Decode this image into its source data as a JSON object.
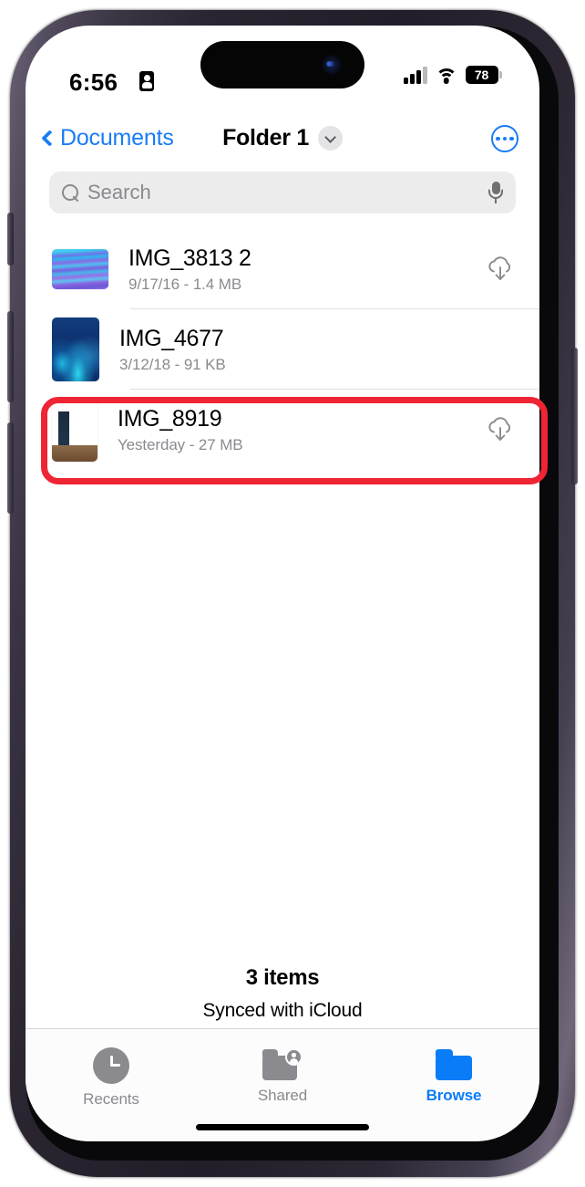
{
  "status_bar": {
    "time": "6:56",
    "focus_icon": "id-card-icon",
    "signal_icon": "cellular-signal-icon",
    "wifi_icon": "wifi-icon",
    "battery_percent": "78"
  },
  "nav_bar": {
    "back_label": "Documents",
    "title": "Folder 1",
    "title_chevron_icon": "chevron-down-icon",
    "more_icon": "ellipsis-circle-icon"
  },
  "search": {
    "placeholder": "Search",
    "value": "",
    "search_icon": "search-icon",
    "mic_icon": "microphone-icon"
  },
  "files": [
    {
      "name": "IMG_3813 2",
      "subtitle": "9/17/16 - 1.4 MB",
      "date": "9/17/16",
      "size": "1.4 MB",
      "thumb": "purple-blue-sky-thumbnail",
      "cloud_icon": "icloud-download-icon",
      "highlighted": false
    },
    {
      "name": "IMG_4677",
      "subtitle": "3/12/18 - 91 KB",
      "date": "3/12/18",
      "size": "91 KB",
      "thumb": "dark-blue-underwater-thumbnail",
      "cloud_icon": "",
      "highlighted": false
    },
    {
      "name": "IMG_8919",
      "subtitle": "Yesterday - 27 MB",
      "date": "Yesterday",
      "size": "27 MB",
      "thumb": "indoor-hallway-thumbnail",
      "cloud_icon": "icloud-download-icon",
      "highlighted": true
    }
  ],
  "footer": {
    "count": "3 items",
    "sync_status": "Synced with iCloud"
  },
  "tab_bar": {
    "tabs": [
      {
        "label": "Recents",
        "icon": "clock-icon",
        "active": false
      },
      {
        "label": "Shared",
        "icon": "shared-folder-icon",
        "active": false
      },
      {
        "label": "Browse",
        "icon": "folder-icon",
        "active": true
      }
    ]
  },
  "colors": {
    "accent_blue": "#0a7cf8",
    "link_blue": "#1a7cf5",
    "highlight_red": "#ef2434",
    "secondary_text": "#8a8a8f",
    "search_bg": "#ececed"
  }
}
